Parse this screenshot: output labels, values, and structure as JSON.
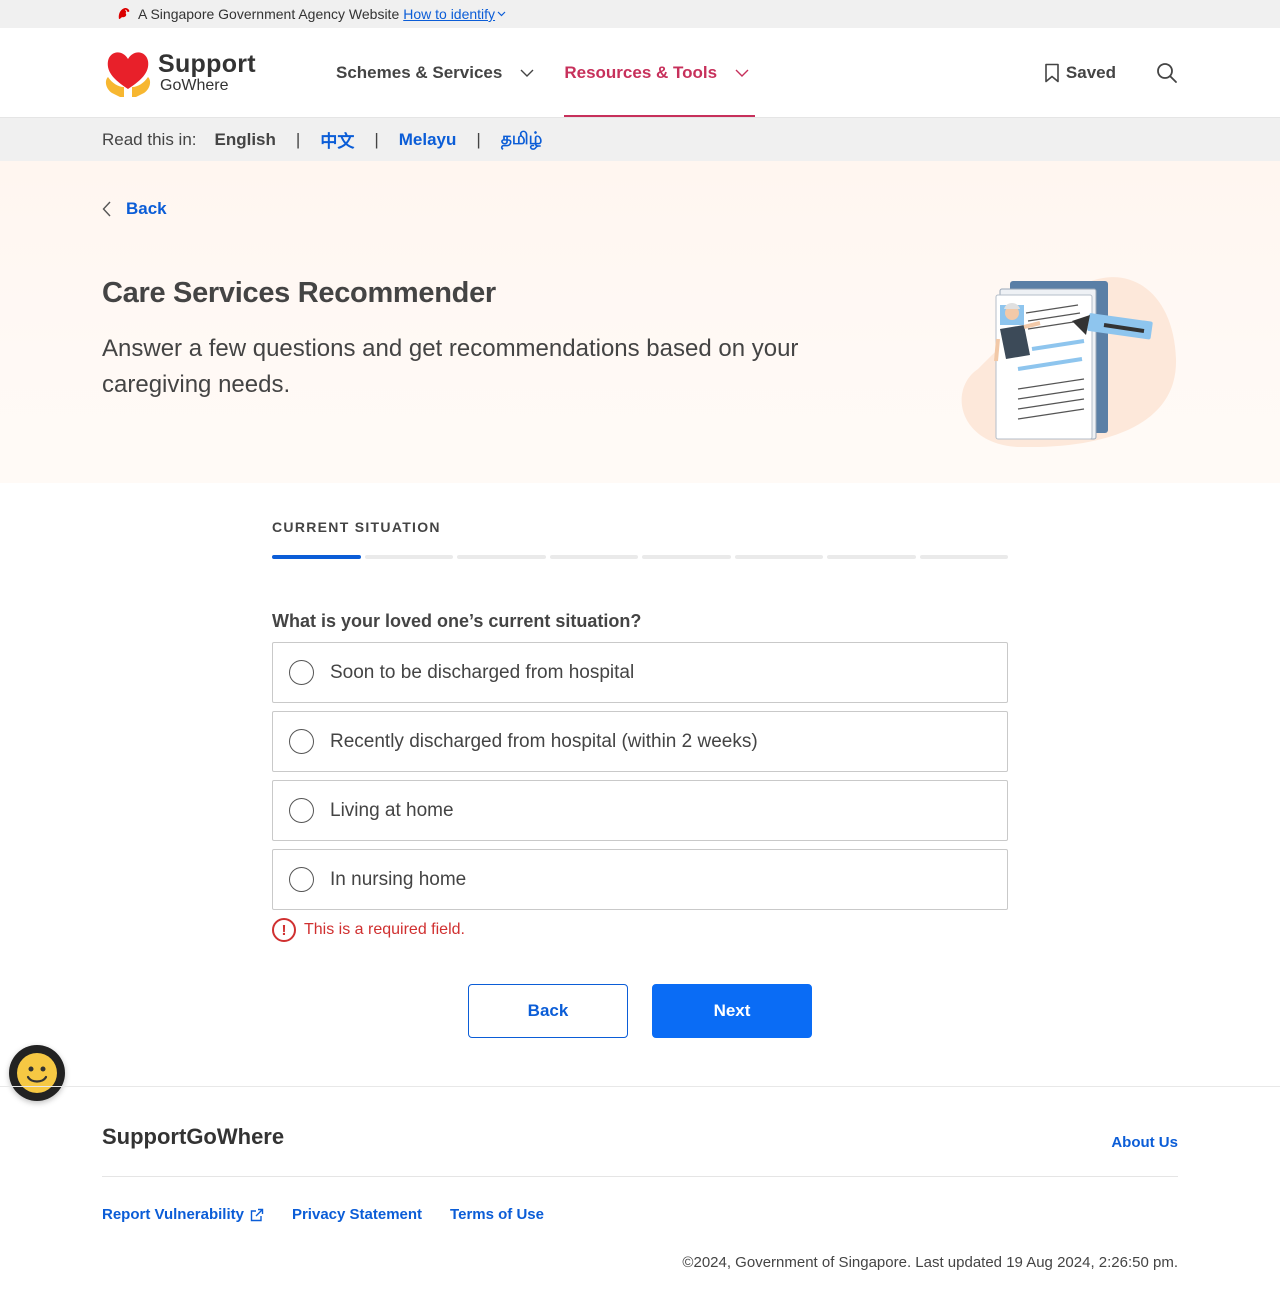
{
  "masthead": {
    "text": "A Singapore Government Agency Website",
    "identify_link": "How to identify"
  },
  "header": {
    "logo": {
      "line1": "Support",
      "line2": "GoWhere"
    },
    "nav": [
      {
        "label": "Schemes & Services",
        "active": false
      },
      {
        "label": "Resources & Tools",
        "active": true
      }
    ],
    "saved_label": "Saved"
  },
  "language_bar": {
    "label": "Read this in:",
    "languages": [
      "English",
      "中文",
      "Melayu",
      "தமிழ்"
    ],
    "current": "English"
  },
  "hero": {
    "back_label": "Back",
    "title": "Care Services Recommender",
    "subtitle": "Answer a few questions and get recommendations based on your caregiving needs."
  },
  "form": {
    "step_label": "CURRENT SITUATION",
    "progress": {
      "current_step": 1,
      "total_steps": 8
    },
    "question": "What is your loved one’s current situation?",
    "options": [
      "Soon to be discharged from hospital",
      "Recently discharged from hospital (within 2 weeks)",
      "Living at home",
      "In nursing home"
    ],
    "error": "This is a required field.",
    "back_button": "Back",
    "next_button": "Next"
  },
  "footer": {
    "brand": "SupportGoWhere",
    "about": "About Us",
    "links": [
      "Report Vulnerability",
      "Privacy Statement",
      "Terms of Use"
    ],
    "copyright": "©2024, Government of Singapore. Last updated 19 Aug 2024, 2:26:50 pm."
  },
  "colors": {
    "accent_blue": "#0b5dd7",
    "primary_button": "#0a6cf5",
    "active_nav": "#c7305b",
    "error_red": "#d03030"
  },
  "icons": [
    "lion-head-icon",
    "chevron-down-icon",
    "bookmark-icon",
    "search-icon",
    "chevron-left-icon",
    "error-icon",
    "external-link-icon",
    "smiley-chat-icon"
  ]
}
